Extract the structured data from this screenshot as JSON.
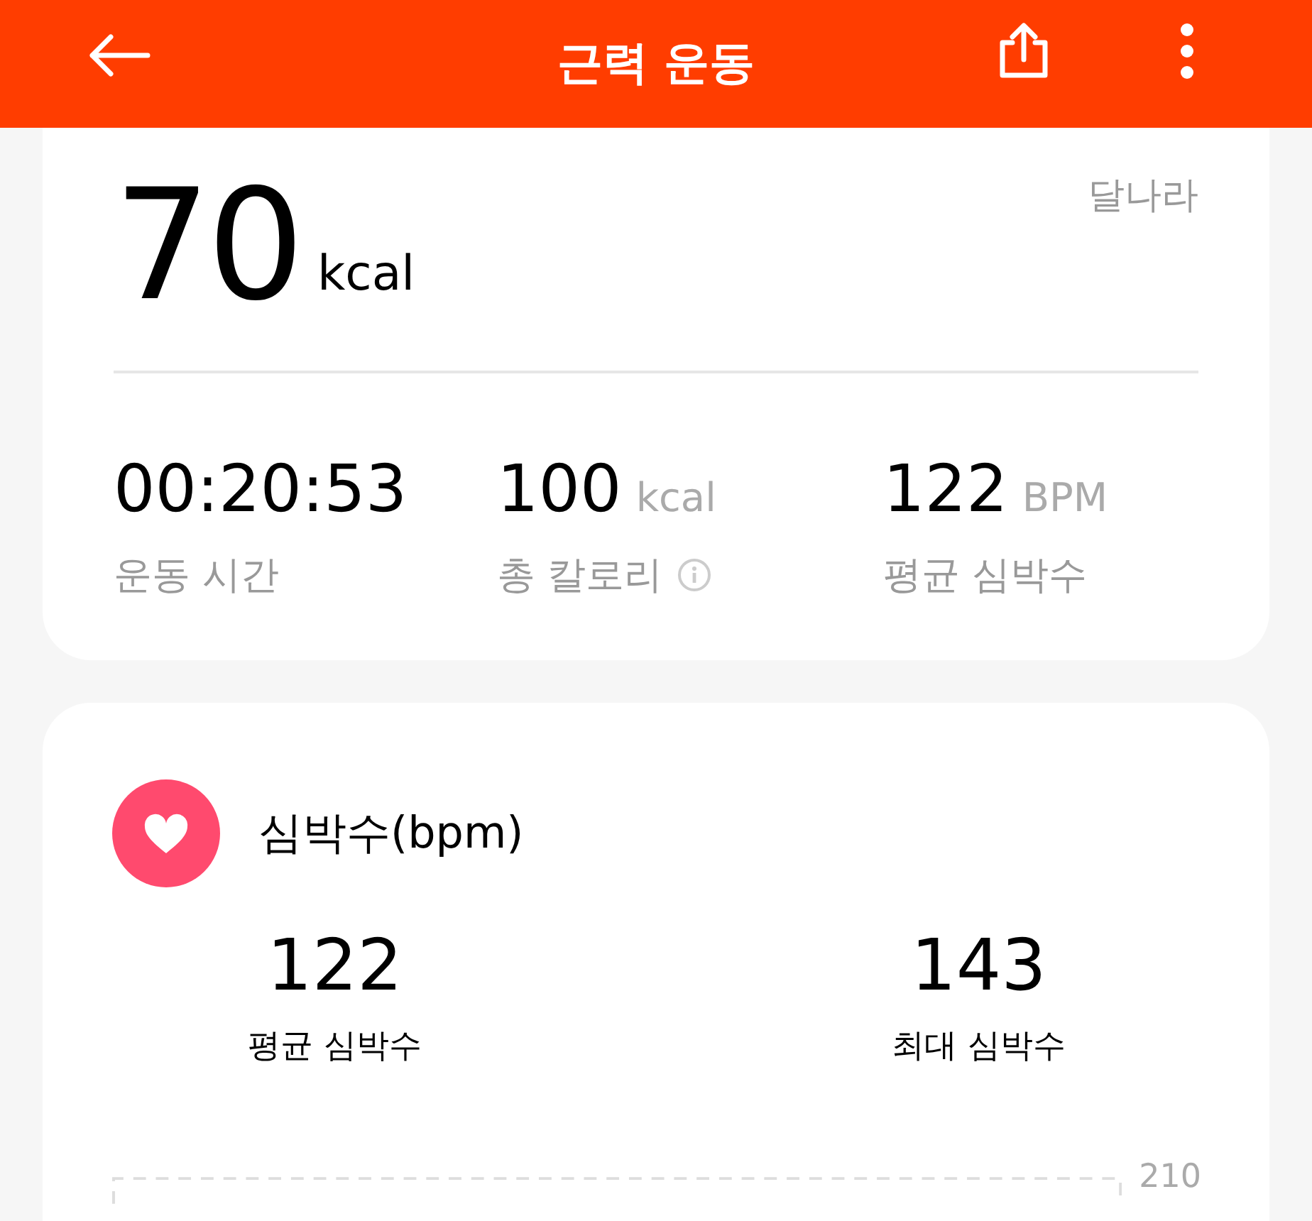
{
  "header": {
    "title": "근력 운동"
  },
  "summary": {
    "calories": "70",
    "calories_unit": "kcal",
    "place": "달나라",
    "stats": [
      {
        "value": "00:20:53",
        "label": "운동 시간",
        "info": false
      },
      {
        "value": "100",
        "unit": "kcal",
        "label": "총 칼로리",
        "info": true
      },
      {
        "value": "122",
        "unit": "BPM",
        "label": "평균 심박수",
        "info": false
      }
    ]
  },
  "heart_rate": {
    "title": "심박수(bpm)",
    "stats": [
      {
        "value": "122",
        "label": "평균 심박수"
      },
      {
        "value": "143",
        "label": "최대 심박수"
      }
    ],
    "chart_top_label": "210"
  }
}
